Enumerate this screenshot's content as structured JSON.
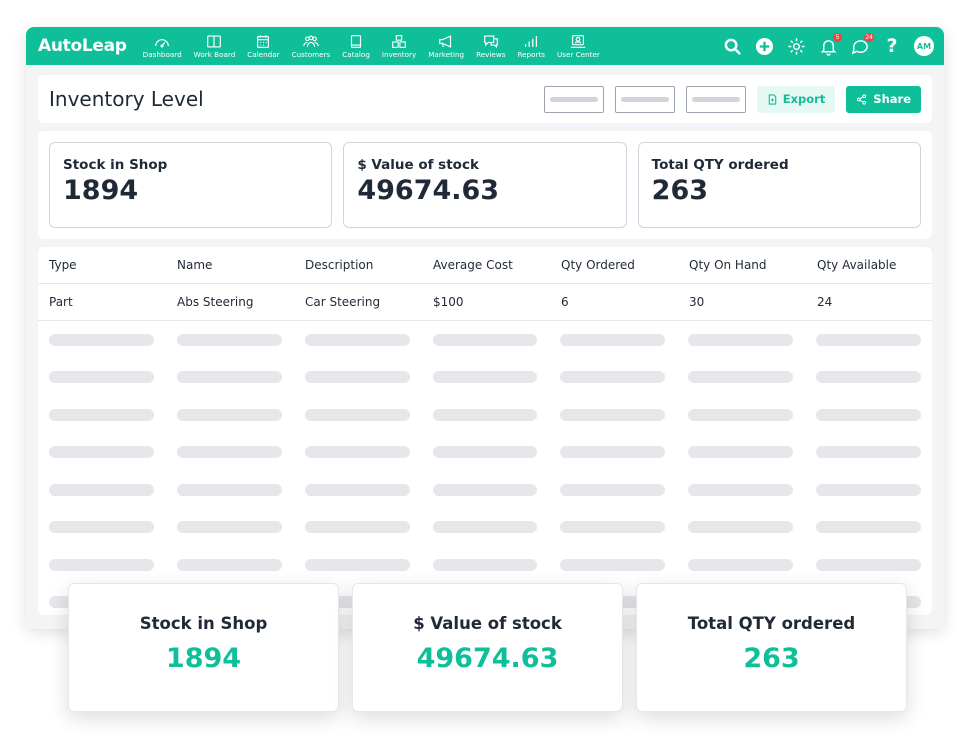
{
  "app": {
    "logo": "AutoLeap"
  },
  "nav": {
    "items": [
      {
        "label": "Dashboard",
        "icon": "dashboard-icon"
      },
      {
        "label": "Work Board",
        "icon": "work-board-icon"
      },
      {
        "label": "Calendar",
        "icon": "calendar-icon"
      },
      {
        "label": "Customers",
        "icon": "customers-icon"
      },
      {
        "label": "Catalog",
        "icon": "catalog-icon"
      },
      {
        "label": "Inventory",
        "icon": "inventory-icon"
      },
      {
        "label": "Marketing",
        "icon": "megaphone-icon"
      },
      {
        "label": "Reviews",
        "icon": "reviews-icon"
      },
      {
        "label": "Reports",
        "icon": "reports-icon"
      },
      {
        "label": "User Center",
        "icon": "user-center-icon"
      }
    ],
    "notification_count": "5",
    "message_count": "24",
    "help_label": "?",
    "avatar_initials": "AM"
  },
  "header": {
    "title": "Inventory Level",
    "export_label": "Export",
    "share_label": "Share"
  },
  "stats": [
    {
      "label": "Stock in Shop",
      "value": "1894"
    },
    {
      "label": "$ Value of stock",
      "value": "49674.63"
    },
    {
      "label": "Total QTY ordered",
      "value": "263"
    }
  ],
  "table": {
    "columns": [
      "Type",
      "Name",
      "Description",
      "Average Cost",
      "Qty Ordered",
      "Qty On Hand",
      "Qty Available"
    ],
    "rows": [
      [
        "Part",
        "Abs Steering",
        "Car Steering",
        "$100",
        "6",
        "30",
        "24"
      ]
    ]
  },
  "colors": {
    "brand": "#0fbf9a",
    "badge": "#ef4444"
  }
}
